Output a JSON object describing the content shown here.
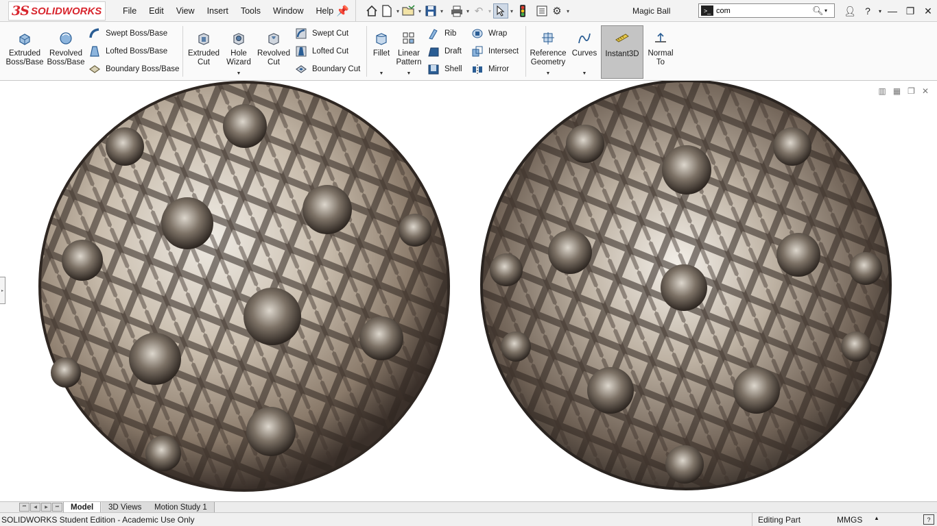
{
  "app": {
    "logo_prefix": "3S",
    "logo_word": "SOLIDWORKS",
    "document_title": "Magic Ball"
  },
  "menu": [
    "File",
    "Edit",
    "View",
    "Insert",
    "Tools",
    "Window",
    "Help"
  ],
  "search": {
    "value": "com"
  },
  "ribbon": {
    "extruded_boss": "Extruded\nBoss/Base",
    "revolved_boss": "Revolved\nBoss/Base",
    "swept_boss": "Swept Boss/Base",
    "lofted_boss": "Lofted Boss/Base",
    "boundary_boss": "Boundary Boss/Base",
    "extruded_cut": "Extruded\nCut",
    "hole_wizard": "Hole\nWizard",
    "revolved_cut": "Revolved\nCut",
    "swept_cut": "Swept Cut",
    "lofted_cut": "Lofted Cut",
    "boundary_cut": "Boundary Cut",
    "fillet": "Fillet",
    "linear_pattern": "Linear\nPattern",
    "rib": "Rib",
    "draft": "Draft",
    "shell": "Shell",
    "wrap": "Wrap",
    "intersect": "Intersect",
    "mirror": "Mirror",
    "reference_geometry": "Reference\nGeometry",
    "curves": "Curves",
    "instant3d": "Instant3D",
    "normal_to": "Normal\nTo"
  },
  "tabs": [
    "Model",
    "3D Views",
    "Motion Study 1"
  ],
  "status": {
    "edition": "SOLIDWORKS Student Edition - Academic Use Only",
    "mode": "Editing Part",
    "units": "MMGS"
  },
  "colors": {
    "brand_red": "#d8262e",
    "metal_light": "#e9e4dc",
    "metal_dark": "#2a2420"
  }
}
